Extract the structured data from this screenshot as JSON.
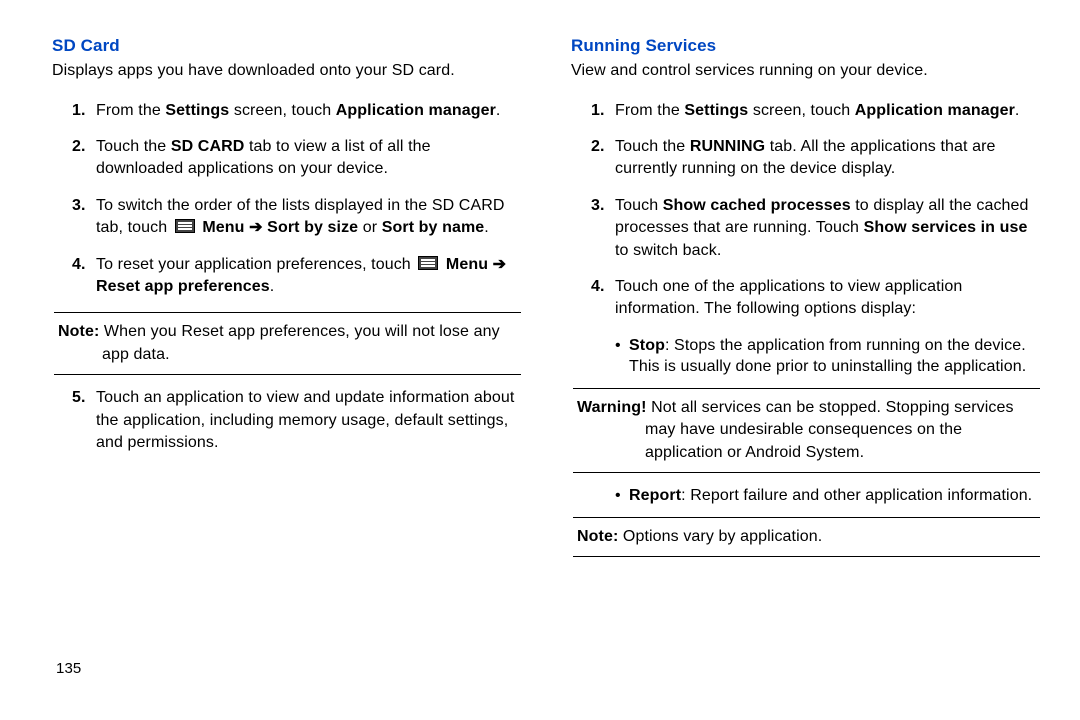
{
  "page_number": "135",
  "left": {
    "title": "SD Card",
    "desc": "Displays apps you have downloaded onto your SD card.",
    "steps": [
      {
        "n": "1.",
        "pre": "From the ",
        "b1": "Settings",
        "mid1": " screen, touch ",
        "b2": "Application manager",
        "post": "."
      },
      {
        "n": "2.",
        "pre": "Touch the ",
        "b1": "SD CARD",
        "post": " tab to view a list of all the downloaded applications on your device."
      },
      {
        "n": "3.",
        "pre": "To switch the order of the lists displayed in the SD CARD tab, touch ",
        "b1": "Menu",
        "arrow": " ➔ ",
        "b2": "Sort by size",
        "mid": " or ",
        "b3": "Sort by name",
        "post": "."
      },
      {
        "n": "4.",
        "pre": "To reset your application preferences, touch ",
        "b1": "Menu",
        "arrow": " ➔ ",
        "b2": "Reset app preferences",
        "post": "."
      }
    ],
    "note": {
      "label": "Note:",
      "text": " When you Reset app preferences, you will not lose any app data."
    },
    "step5": {
      "n": "5.",
      "text": "Touch an application to view and update information about the application, including memory usage, default settings, and permissions."
    }
  },
  "right": {
    "title": "Running Services",
    "desc": "View and control services running on your device.",
    "steps": [
      {
        "n": "1.",
        "pre": "From the ",
        "b1": "Settings",
        "mid1": " screen, touch ",
        "b2": "Application manager",
        "post": "."
      },
      {
        "n": "2.",
        "pre": "Touch the ",
        "b1": "RUNNING",
        "post": " tab. All the applications that are currently running on the device display."
      },
      {
        "n": "3.",
        "pre": "Touch ",
        "b1": "Show cached processes",
        "mid": " to display all the cached processes that are running. Touch ",
        "b2": "Show services in use",
        "post": " to switch back."
      },
      {
        "n": "4.",
        "text": "Touch one of the applications to view application information. The following options display:"
      }
    ],
    "bullet_stop": {
      "label": "Stop",
      "text": ": Stops the application from running on the device. This is usually done prior to uninstalling the application."
    },
    "warning": {
      "label": "Warning!",
      "text": " Not all services can be stopped. Stopping services may have undesirable consequences on the application or Android System."
    },
    "bullet_report": {
      "label": "Report",
      "text": ": Report failure and other application information."
    },
    "note2": {
      "label": "Note:",
      "text": " Options vary by application."
    }
  }
}
